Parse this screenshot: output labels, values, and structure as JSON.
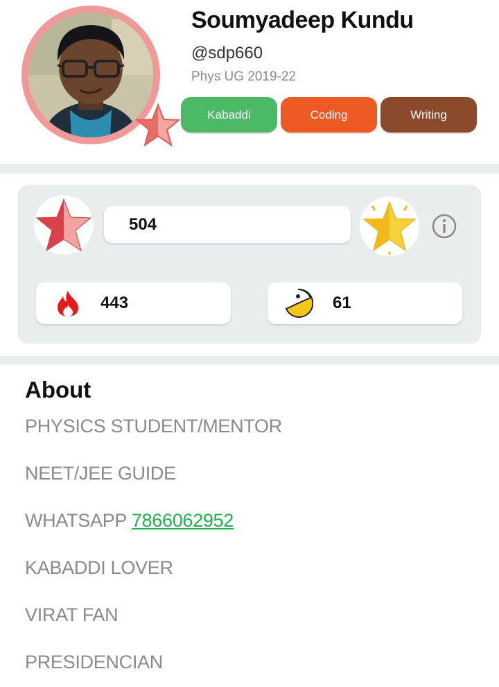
{
  "profile": {
    "name": "Soumyadeep Kundu",
    "handle": "@sdp660",
    "batch": "Phys UG 2019-22"
  },
  "tags": [
    {
      "label": "Kabaddi",
      "color": "#4cb966"
    },
    {
      "label": "Coding",
      "color": "#ee5a24"
    },
    {
      "label": "Writing",
      "color": "#8b4a2b"
    }
  ],
  "stats": {
    "stars": "504",
    "streak": "443",
    "pacman": "61"
  },
  "about": {
    "title": "About",
    "lines": [
      "PHYSICS STUDENT/MENTOR",
      "NEET/JEE GUIDE",
      "WHATSAPP",
      "KABADDI LOVER",
      "VIRAT FAN",
      "PRESIDENCIAN"
    ],
    "whatsapp_number": "7866062952"
  },
  "icons": {
    "avatar_badge": "star-icon",
    "stars": "red-star-icon",
    "level": "gold-star-icon",
    "info": "info-icon",
    "streak": "fire-icon",
    "pacman": "pacman-icon"
  },
  "colors": {
    "ring": "#ef9a98",
    "card": "#e9eded",
    "link": "#22b14c"
  }
}
